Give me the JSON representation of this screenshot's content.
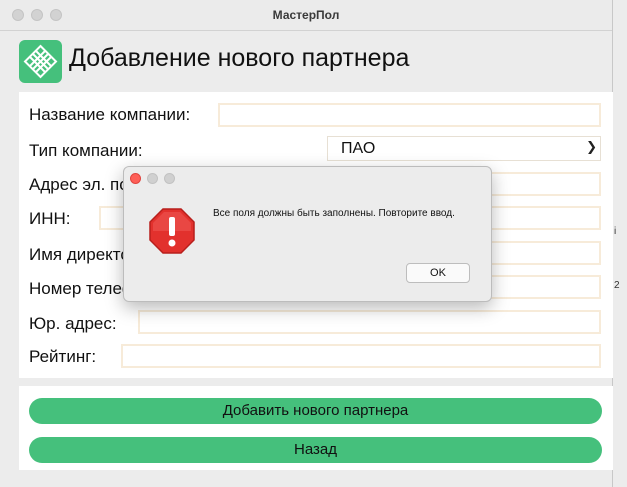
{
  "window": {
    "title": "МастерПол"
  },
  "header": {
    "title": "Добавление нового партнера",
    "logo_icon": "mosaic-tile-logo"
  },
  "form": {
    "company_name": {
      "label": "Название компании:",
      "value": ""
    },
    "company_type": {
      "label": "Тип компании:",
      "value": "ПАО"
    },
    "email": {
      "label": "Адрес эл. почты:",
      "value": ""
    },
    "inn": {
      "label": "ИНН:",
      "value": ""
    },
    "director": {
      "label": "Имя директора:",
      "value": ""
    },
    "phone": {
      "label": "Номер телефона:",
      "value": ""
    },
    "legal_address": {
      "label": "Юр. адрес:",
      "value": ""
    },
    "rating": {
      "label": "Рейтинг:",
      "value": ""
    }
  },
  "actions": {
    "add_label": "Добавить нового партнера",
    "back_label": "Назад"
  },
  "dialog": {
    "message": "Все поля должны быть заполнены. Повторите ввод.",
    "ok_label": "OK",
    "icon": "stop-alert-icon"
  },
  "background_glyphs": [
    "i",
    "2"
  ],
  "colors": {
    "accent": "#45c07c",
    "input_border": "#f7ebd9",
    "alert_red": "#e2312d"
  }
}
